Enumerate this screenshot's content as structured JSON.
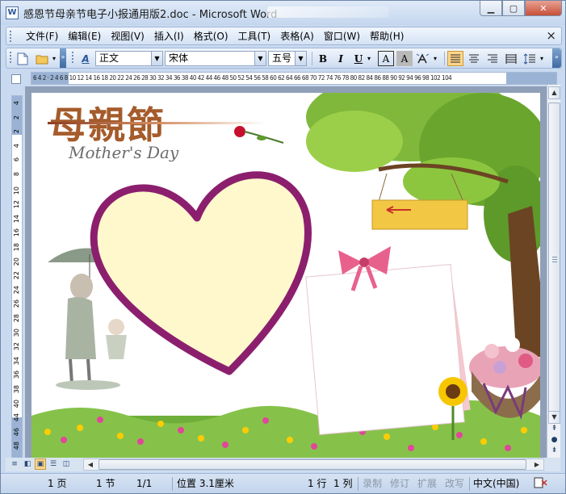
{
  "window": {
    "title": "感恩节母亲节电子小报通用版2.doc - Microsoft Word",
    "min_label": "▁",
    "max_label": "▢",
    "close_label": "✕"
  },
  "menu": {
    "items": [
      "文件(F)",
      "编辑(E)",
      "视图(V)",
      "插入(I)",
      "格式(O)",
      "工具(T)",
      "表格(A)",
      "窗口(W)",
      "帮助(H)"
    ],
    "close": "×"
  },
  "toolbar": {
    "style": "正文",
    "font": "宋体",
    "size": "五号",
    "bold": "B",
    "italic": "I",
    "underline": "U",
    "char_border": "A",
    "char_shading": "A"
  },
  "ruler": {
    "h_ticks": "6  4  2  ·  2  4  6  8 10 12 14 16 18 20 22 24 26 28 30 32 34 36 38 40 42 44 46 48 50 52 54 56 58 60 62 64 66 68 70 72 74 76 78 80 82 84 86 88 90 92 94 96 98  102 104",
    "v_ticks": [
      "4",
      "2",
      "2",
      "4",
      "6",
      "8",
      "10",
      "12",
      "14",
      "16",
      "18",
      "20",
      "22",
      "24",
      "26",
      "28",
      "30",
      "32",
      "34",
      "36",
      "38",
      "40",
      "44",
      "46",
      "48"
    ]
  },
  "page_art": {
    "title": "母親節",
    "subtitle": "Mother's Day"
  },
  "status": {
    "page": "1 页",
    "section": "1 节",
    "page_of": "1/1",
    "position": "位置 3.1厘米",
    "line": "1 行",
    "column": "1 列",
    "rec": "录制",
    "trk": "修订",
    "ext": "扩展",
    "ovr": "改写",
    "language": "中文(中国)"
  },
  "colors": {
    "heart_stroke": "#8b1f6e",
    "heart_fill": "#fff8cc",
    "title_brown": "#a55b2b",
    "window_frame": "#c9daf0"
  }
}
